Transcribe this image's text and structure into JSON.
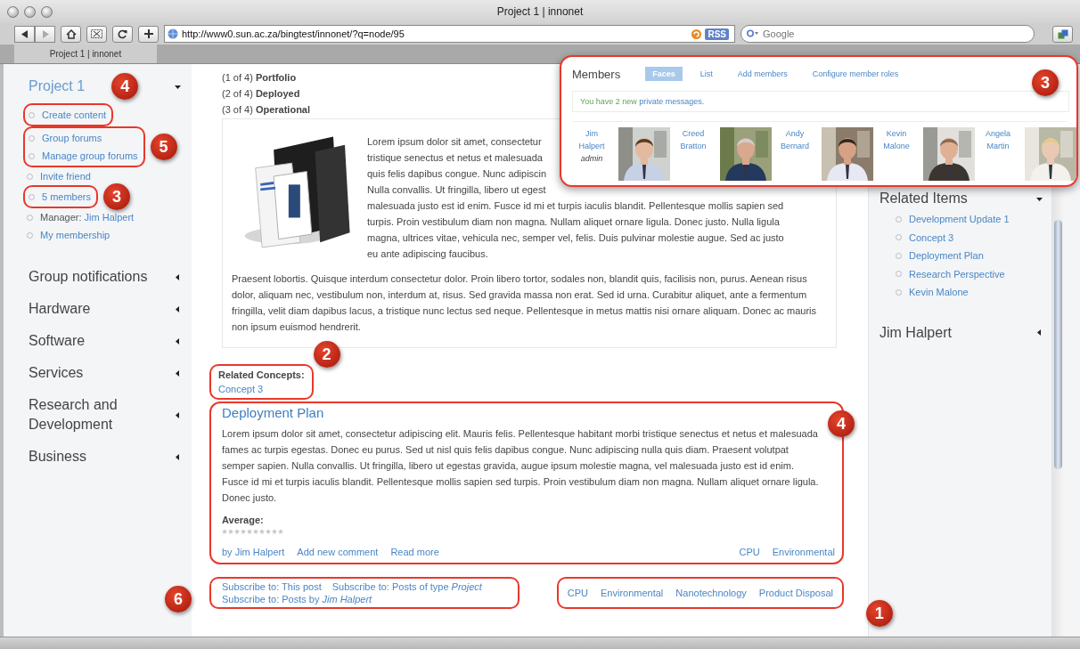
{
  "window": {
    "title": "Project 1 | innonet"
  },
  "toolbar": {
    "url": "http://www0.sun.ac.za/bingtest/innonet/?q=node/95",
    "rss": "RSS",
    "search_placeholder": "Google"
  },
  "tabs": [
    {
      "label": "Project 1 | innonet",
      "selected": true
    }
  ],
  "sidebar": {
    "title": "Project 1",
    "expanded": true,
    "callout": "4",
    "link_groups": [
      {
        "outlined": true,
        "items": [
          {
            "kind": "link",
            "text": "Create content"
          }
        ]
      },
      {
        "outlined": true,
        "callout": "5",
        "items": [
          {
            "kind": "link",
            "text": "Group forums"
          },
          {
            "kind": "link",
            "text": "Manage group forums"
          }
        ]
      },
      {
        "outlined": false,
        "items": [
          {
            "kind": "link",
            "text": "Invite friend"
          }
        ]
      },
      {
        "outlined": true,
        "callout": "3",
        "items": [
          {
            "kind": "link",
            "text": "5 members"
          }
        ]
      },
      {
        "outlined": false,
        "items": [
          {
            "kind": "labelled",
            "label": "Manager:",
            "text": "Jim Halpert"
          },
          {
            "kind": "link",
            "text": "My membership"
          }
        ]
      }
    ],
    "sections": [
      {
        "title": "Group notifications",
        "expanded": false
      },
      {
        "title": "Hardware",
        "expanded": false
      },
      {
        "title": "Software",
        "expanded": false
      },
      {
        "title": "Services",
        "expanded": false
      },
      {
        "title": "Research and Development",
        "expanded": false
      },
      {
        "title": "Business",
        "expanded": false
      }
    ]
  },
  "content": {
    "steps": [
      {
        "prefix": "(1 of 4)",
        "label": "Portfolio"
      },
      {
        "prefix": "(2 of 4)",
        "label": "Deployed"
      },
      {
        "prefix": "(3 of 4)",
        "label": "Operational"
      }
    ],
    "lead_lines": [
      "Lorem ipsum dolor sit amet, consectetur",
      "tristique senectus et netus et malesuada",
      "quis felis dapibus congue. Nunc adipiscin",
      "Nulla convallis. Ut fringilla, libero ut egest",
      "malesuada justo est id enim. Fusce id mi et turpis iaculis blandit. Pellentesque mollis sapien sed",
      "turpis. Proin vestibulum diam non magna. Nullam aliquet ornare ligula. Donec justo. Nulla ligula",
      "magna, ultrices vitae, vehicula nec, semper vel, felis. Duis pulvinar molestie augue. Sed ac justo",
      "eu ante adipiscing faucibus."
    ],
    "paragraph": "Praesent lobortis. Quisque interdum consectetur dolor. Proin libero tortor, sodales non, blandit quis, facilisis non, purus. Aenean risus dolor, aliquam nec, vestibulum non, interdum at, risus. Sed gravida massa non erat. Sed id urna. Curabitur aliquet, ante a fermentum fringilla, velit diam dapibus lacus, a tristique nunc lectus sed neque. Pellentesque in metus mattis nisi ornare aliquam. Donec ac mauris non ipsum euismod hendrerit.",
    "related": {
      "label": "Related Concepts:",
      "links": [
        "Concept 3"
      ],
      "callout": "2"
    },
    "teaser": {
      "title": "Deployment Plan",
      "callout": "4",
      "body": "Lorem ipsum dolor sit amet, consectetur adipiscing elit. Mauris felis. Pellentesque habitant morbi tristique senectus et netus et malesuada fames ac turpis egestas. Donec eu purus. Sed ut nisl quis felis dapibus congue. Nunc adipiscing nulla quis diam. Praesent volutpat semper sapien. Nulla convallis. Ut fringilla, libero ut egestas gravida, augue ipsum molestie magna, vel malesuada justo est id enim. Fusce id mi et turpis iaculis blandit. Pellentesque mollis sapien sed turpis. Proin vestibulum diam non magna. Nullam aliquet ornare ligula. Donec justo.",
      "rating_label": "Average:",
      "stars": 0,
      "links": [
        "by Jim Halpert",
        "Add new comment",
        "Read more"
      ],
      "tags": [
        "CPU",
        "Environmental"
      ]
    },
    "subscribe": {
      "callout": "6",
      "links": [
        "Subscribe to: This post",
        "Subscribe to: Posts of type *Project*",
        "Subscribe to: Posts by *Jim Halpert*"
      ]
    },
    "tags": {
      "callout": "1",
      "links": [
        "CPU",
        "Environmental",
        "Nanotechnology",
        "Product Disposal"
      ]
    }
  },
  "members_panel": {
    "title": "Members",
    "callout": "3",
    "tabs": [
      {
        "label": "Faces",
        "selected": true
      },
      {
        "label": "List",
        "selected": false
      },
      {
        "label": "Add members",
        "selected": false
      },
      {
        "label": "Configure member roles",
        "selected": false
      }
    ],
    "message": "You have 2 new",
    "message_link": "private messages.",
    "members": [
      {
        "name": "Jim Halpert",
        "role": "admin"
      },
      {
        "name": "Creed Bratton"
      },
      {
        "name": "Andy Bernard"
      },
      {
        "name": "Kevin Malone"
      },
      {
        "name": "Angela Martin"
      }
    ]
  },
  "right": {
    "blocks": [
      {
        "title": "Related Items",
        "expanded": true,
        "items": [
          "Development Update 1",
          "Concept 3",
          "Deployment Plan",
          "Research Perspective",
          "Kevin Malone"
        ]
      },
      {
        "title": "Jim Halpert",
        "expanded": false
      }
    ]
  }
}
